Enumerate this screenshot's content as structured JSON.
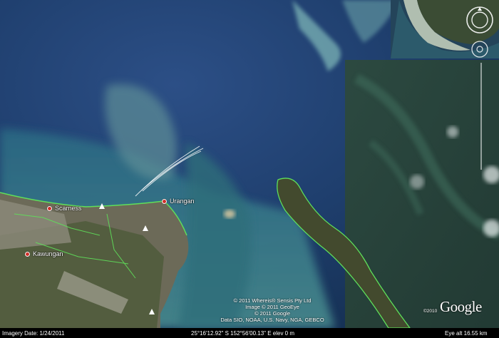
{
  "map": {
    "places": [
      {
        "name": "Scarness"
      },
      {
        "name": "Urangan"
      },
      {
        "name": "Kawungan"
      }
    ],
    "attribution_lines": [
      "© 2011 Whereis® Sensis Pty Ltd",
      "Image © 2011 GeoEye",
      "© 2011 Google",
      "Data SIO, NOAA, U.S. Navy, NGA, GEBCO"
    ],
    "logo_text": "Google",
    "logo_copyright": "©2010",
    "status": {
      "imagery_date": "Imagery Date: 1/24/2011",
      "coordinates": "25°16'12.92\" S  152°56'00.13\" E  elev    0 m",
      "eye_alt": "Eye alt    16.55 km"
    },
    "colors": {
      "deep_water": "#1f3f6e",
      "shallow_water": "#3c7f8e",
      "land": "#3f4a2c",
      "road_highlight": "#5fe05a",
      "place_marker": "#d0302a"
    },
    "icons": [
      "navigation-compass-icon",
      "look-joystick-icon",
      "zoom-slider-icon",
      "park-icon"
    ]
  }
}
